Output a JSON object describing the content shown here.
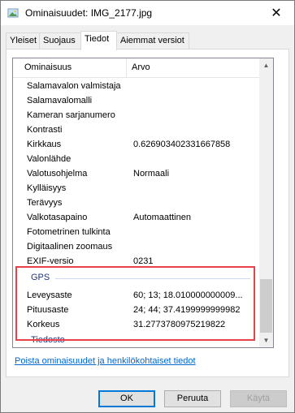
{
  "window": {
    "title": "Ominaisuudet: IMG_2177.jpg"
  },
  "tabs": [
    {
      "label": "Yleiset"
    },
    {
      "label": "Suojaus"
    },
    {
      "label": "Tiedot"
    },
    {
      "label": "Aiemmat versiot"
    }
  ],
  "table": {
    "columns": [
      "Ominaisuus",
      "Arvo"
    ],
    "rows": [
      {
        "name": "Salamavalon valmistaja",
        "value": ""
      },
      {
        "name": "Salamavalomalli",
        "value": ""
      },
      {
        "name": "Kameran sarjanumero",
        "value": ""
      },
      {
        "name": "Kontrasti",
        "value": ""
      },
      {
        "name": "Kirkkaus",
        "value": "0.626903402331667858"
      },
      {
        "name": "Valonlähde",
        "value": ""
      },
      {
        "name": "Valotusohjelma",
        "value": "Normaali"
      },
      {
        "name": "Kylläisyys",
        "value": ""
      },
      {
        "name": "Terävyys",
        "value": ""
      },
      {
        "name": "Valkotasapaino",
        "value": "Automaattinen"
      },
      {
        "name": "Fotometrinen tulkinta",
        "value": ""
      },
      {
        "name": "Digitaalinen zoomaus",
        "value": ""
      },
      {
        "name": "EXIF-versio",
        "value": "0231"
      }
    ],
    "gps_group": "GPS",
    "gps_rows": [
      {
        "name": "Leveysaste",
        "value": "60; 13; 18.010000000009..."
      },
      {
        "name": "Pituusaste",
        "value": "24; 44; 37.4199999999982"
      },
      {
        "name": "Korkeus",
        "value": "31.2773780975219822"
      }
    ],
    "next_group": "Tiedosto"
  },
  "link": "Poista ominaisuudet ja henkilökohtaiset tiedot",
  "buttons": {
    "ok": "OK",
    "cancel": "Peruuta",
    "apply": "Käytä"
  },
  "colors": {
    "highlight": "#e8414a",
    "link": "#0066cc",
    "group": "#1e3287"
  }
}
